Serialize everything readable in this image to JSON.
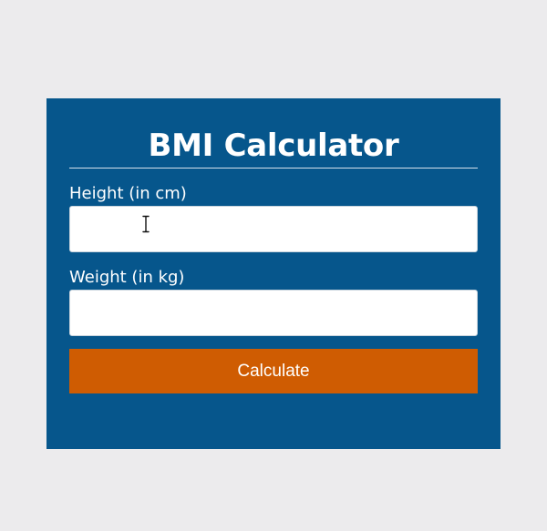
{
  "calculator": {
    "title": "BMI Calculator",
    "height": {
      "label": "Height (in cm)",
      "value": ""
    },
    "weight": {
      "label": "Weight (in kg)",
      "value": ""
    },
    "calculate_label": "Calculate"
  },
  "colors": {
    "page_background": "#ecebed",
    "card_background": "#06568c",
    "button_background": "#cf5c02",
    "text": "#ffffff"
  },
  "icons": {
    "text_cursor": "text-cursor-icon"
  }
}
